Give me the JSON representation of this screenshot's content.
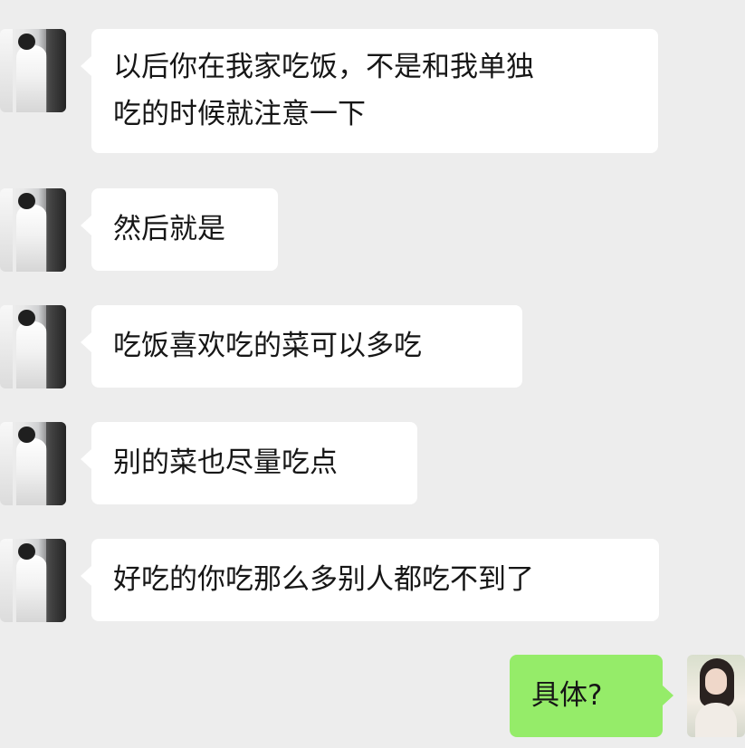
{
  "conversation": {
    "incoming": [
      {
        "text": "以后你在我家吃饭，不是和我单独\n吃的时候就注意一下"
      },
      {
        "text": "然后就是"
      },
      {
        "text": "吃饭喜欢吃的菜可以多吃"
      },
      {
        "text": "别的菜也尽量吃点"
      },
      {
        "text": "好吃的你吃那么多别人都吃不到了"
      }
    ],
    "outgoing": [
      {
        "text": "具体?"
      }
    ]
  },
  "colors": {
    "background": "#ededed",
    "incoming_bubble": "#ffffff",
    "outgoing_bubble": "#95ec69",
    "text": "#161616"
  },
  "icons": {
    "incoming_avatar": "avatar-photo-person",
    "outgoing_avatar": "avatar-photo-person"
  }
}
